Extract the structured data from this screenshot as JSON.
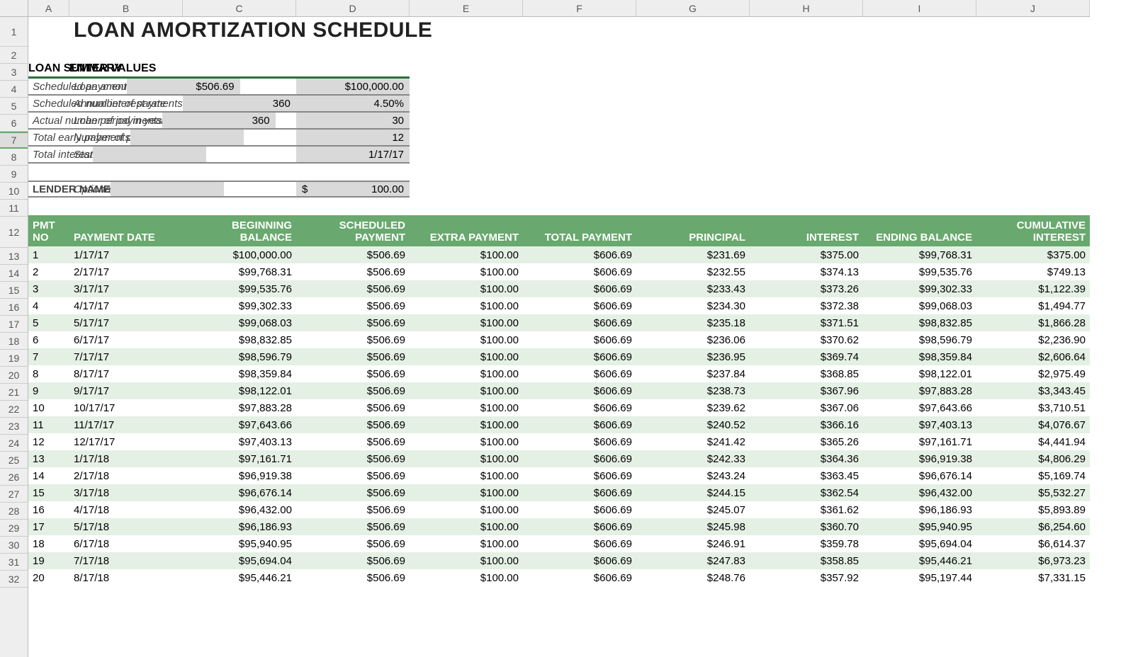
{
  "columns": [
    "A",
    "B",
    "C",
    "D",
    "E",
    "F",
    "G",
    "H",
    "I",
    "J"
  ],
  "row_numbers": [
    1,
    2,
    3,
    4,
    5,
    6,
    7,
    8,
    9,
    10,
    11,
    12,
    13,
    14,
    15,
    16,
    17,
    18,
    19,
    20,
    21,
    22,
    23,
    24,
    25,
    26,
    27,
    28,
    29,
    30,
    31,
    32
  ],
  "selected_row": 7,
  "title": "LOAN AMORTIZATION SCHEDULE",
  "enter_values": {
    "header": "ENTER VALUES",
    "rows": [
      {
        "label": "Loan amount",
        "value": "$100,000.00"
      },
      {
        "label": "Annual interest rate",
        "value": "4.50%"
      },
      {
        "label": "Loan period in years",
        "value": "30"
      },
      {
        "label": "Number of payments per year",
        "value": "12"
      },
      {
        "label": "Start date of loan",
        "value": "1/17/17"
      }
    ],
    "optional_label": "Optional extra payments",
    "optional_prefix": "$",
    "optional_value": "100.00"
  },
  "loan_summary": {
    "header": "LOAN SUMMARY",
    "rows": [
      {
        "label": "Scheduled payment",
        "value": "$506.69"
      },
      {
        "label": "Scheduled number of payments",
        "value": "360"
      },
      {
        "label": "Actual number of payments",
        "value": "360"
      },
      {
        "label": "Total early payments",
        "value": ""
      },
      {
        "label": "Total interest",
        "value": ""
      }
    ],
    "lender_label": "LENDER NAME"
  },
  "schedule": {
    "headers": {
      "pmt_no": "PMT NO",
      "date": "PAYMENT DATE",
      "begin": "BEGINNING BALANCE",
      "sched": "SCHEDULED PAYMENT",
      "extra": "EXTRA PAYMENT",
      "total": "TOTAL PAYMENT",
      "principal": "PRINCIPAL",
      "interest": "INTEREST",
      "end": "ENDING BALANCE",
      "cum": "CUMULATIVE INTEREST"
    },
    "rows": [
      {
        "no": "1",
        "date": "1/17/17",
        "begin": "$100,000.00",
        "sched": "$506.69",
        "extra": "$100.00",
        "total": "$606.69",
        "principal": "$231.69",
        "interest": "$375.00",
        "end": "$99,768.31",
        "cum": "$375.00"
      },
      {
        "no": "2",
        "date": "2/17/17",
        "begin": "$99,768.31",
        "sched": "$506.69",
        "extra": "$100.00",
        "total": "$606.69",
        "principal": "$232.55",
        "interest": "$374.13",
        "end": "$99,535.76",
        "cum": "$749.13"
      },
      {
        "no": "3",
        "date": "3/17/17",
        "begin": "$99,535.76",
        "sched": "$506.69",
        "extra": "$100.00",
        "total": "$606.69",
        "principal": "$233.43",
        "interest": "$373.26",
        "end": "$99,302.33",
        "cum": "$1,122.39"
      },
      {
        "no": "4",
        "date": "4/17/17",
        "begin": "$99,302.33",
        "sched": "$506.69",
        "extra": "$100.00",
        "total": "$606.69",
        "principal": "$234.30",
        "interest": "$372.38",
        "end": "$99,068.03",
        "cum": "$1,494.77"
      },
      {
        "no": "5",
        "date": "5/17/17",
        "begin": "$99,068.03",
        "sched": "$506.69",
        "extra": "$100.00",
        "total": "$606.69",
        "principal": "$235.18",
        "interest": "$371.51",
        "end": "$98,832.85",
        "cum": "$1,866.28"
      },
      {
        "no": "6",
        "date": "6/17/17",
        "begin": "$98,832.85",
        "sched": "$506.69",
        "extra": "$100.00",
        "total": "$606.69",
        "principal": "$236.06",
        "interest": "$370.62",
        "end": "$98,596.79",
        "cum": "$2,236.90"
      },
      {
        "no": "7",
        "date": "7/17/17",
        "begin": "$98,596.79",
        "sched": "$506.69",
        "extra": "$100.00",
        "total": "$606.69",
        "principal": "$236.95",
        "interest": "$369.74",
        "end": "$98,359.84",
        "cum": "$2,606.64"
      },
      {
        "no": "8",
        "date": "8/17/17",
        "begin": "$98,359.84",
        "sched": "$506.69",
        "extra": "$100.00",
        "total": "$606.69",
        "principal": "$237.84",
        "interest": "$368.85",
        "end": "$98,122.01",
        "cum": "$2,975.49"
      },
      {
        "no": "9",
        "date": "9/17/17",
        "begin": "$98,122.01",
        "sched": "$506.69",
        "extra": "$100.00",
        "total": "$606.69",
        "principal": "$238.73",
        "interest": "$367.96",
        "end": "$97,883.28",
        "cum": "$3,343.45"
      },
      {
        "no": "10",
        "date": "10/17/17",
        "begin": "$97,883.28",
        "sched": "$506.69",
        "extra": "$100.00",
        "total": "$606.69",
        "principal": "$239.62",
        "interest": "$367.06",
        "end": "$97,643.66",
        "cum": "$3,710.51"
      },
      {
        "no": "11",
        "date": "11/17/17",
        "begin": "$97,643.66",
        "sched": "$506.69",
        "extra": "$100.00",
        "total": "$606.69",
        "principal": "$240.52",
        "interest": "$366.16",
        "end": "$97,403.13",
        "cum": "$4,076.67"
      },
      {
        "no": "12",
        "date": "12/17/17",
        "begin": "$97,403.13",
        "sched": "$506.69",
        "extra": "$100.00",
        "total": "$606.69",
        "principal": "$241.42",
        "interest": "$365.26",
        "end": "$97,161.71",
        "cum": "$4,441.94"
      },
      {
        "no": "13",
        "date": "1/17/18",
        "begin": "$97,161.71",
        "sched": "$506.69",
        "extra": "$100.00",
        "total": "$606.69",
        "principal": "$242.33",
        "interest": "$364.36",
        "end": "$96,919.38",
        "cum": "$4,806.29"
      },
      {
        "no": "14",
        "date": "2/17/18",
        "begin": "$96,919.38",
        "sched": "$506.69",
        "extra": "$100.00",
        "total": "$606.69",
        "principal": "$243.24",
        "interest": "$363.45",
        "end": "$96,676.14",
        "cum": "$5,169.74"
      },
      {
        "no": "15",
        "date": "3/17/18",
        "begin": "$96,676.14",
        "sched": "$506.69",
        "extra": "$100.00",
        "total": "$606.69",
        "principal": "$244.15",
        "interest": "$362.54",
        "end": "$96,432.00",
        "cum": "$5,532.27"
      },
      {
        "no": "16",
        "date": "4/17/18",
        "begin": "$96,432.00",
        "sched": "$506.69",
        "extra": "$100.00",
        "total": "$606.69",
        "principal": "$245.07",
        "interest": "$361.62",
        "end": "$96,186.93",
        "cum": "$5,893.89"
      },
      {
        "no": "17",
        "date": "5/17/18",
        "begin": "$96,186.93",
        "sched": "$506.69",
        "extra": "$100.00",
        "total": "$606.69",
        "principal": "$245.98",
        "interest": "$360.70",
        "end": "$95,940.95",
        "cum": "$6,254.60"
      },
      {
        "no": "18",
        "date": "6/17/18",
        "begin": "$95,940.95",
        "sched": "$506.69",
        "extra": "$100.00",
        "total": "$606.69",
        "principal": "$246.91",
        "interest": "$359.78",
        "end": "$95,694.04",
        "cum": "$6,614.37"
      },
      {
        "no": "19",
        "date": "7/17/18",
        "begin": "$95,694.04",
        "sched": "$506.69",
        "extra": "$100.00",
        "total": "$606.69",
        "principal": "$247.83",
        "interest": "$358.85",
        "end": "$95,446.21",
        "cum": "$6,973.23"
      },
      {
        "no": "20",
        "date": "8/17/18",
        "begin": "$95,446.21",
        "sched": "$506.69",
        "extra": "$100.00",
        "total": "$606.69",
        "principal": "$248.76",
        "interest": "$357.92",
        "end": "$95,197.44",
        "cum": "$7,331.15"
      }
    ]
  }
}
